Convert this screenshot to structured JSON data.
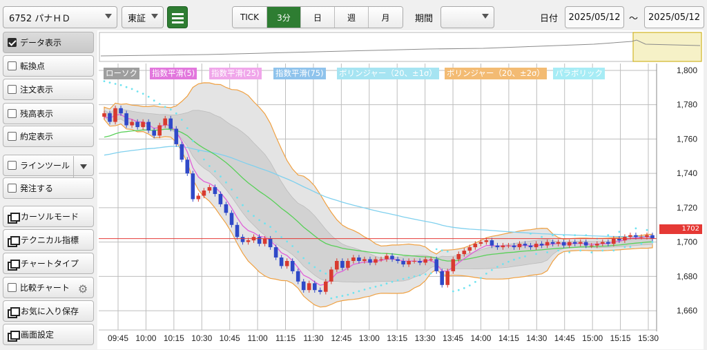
{
  "header": {
    "symbol": "6752 パナＨＤ",
    "market": "東証",
    "periods": [
      "TICK",
      "3分",
      "日",
      "週",
      "月"
    ],
    "active_period": "3分",
    "range_label": "期間",
    "range_value": "",
    "date_label": "日付",
    "date_from": "2025/05/12",
    "date_separator": "〜",
    "date_to": "2025/05/12"
  },
  "sidebar": {
    "data_display": "データ表示",
    "turning_point": "転換点",
    "order_display": "注文表示",
    "balance_display": "残高表示",
    "execution_display": "約定表示",
    "line_tool": "ラインツール",
    "place_order": "発注する",
    "cursor_mode": "カーソルモード",
    "technical": "テクニカル指標",
    "chart_type": "チャートタイプ",
    "compare_chart": "比較チャート",
    "save_favorite": "お気に入り保存",
    "screen_settings": "画面設定"
  },
  "legend": {
    "candle": "ローソク",
    "ema5": "指数平滑(5)",
    "ema25": "指数平滑(25)",
    "ema75": "指数平滑(75)",
    "boll1": "ボリンジャー（20、±1σ）",
    "boll2": "ボリンジャー（20、±2σ）",
    "parabolic": "パラボリック"
  },
  "colors": {
    "up": "#d83a2f",
    "down": "#2f49c8",
    "ema5": "#e060d8",
    "ema25": "#58d058",
    "ema75": "#7fd0ee",
    "band2": "#f0a040",
    "parabolic": "#6fe3f0",
    "price_line": "#e53935",
    "active": "#2e7d32"
  },
  "last_price": "1702",
  "chart_data": {
    "type": "candlestick",
    "x_ticks": [
      "09:45",
      "10:00",
      "10:15",
      "10:30",
      "10:45",
      "11:00",
      "11:15",
      "11:30",
      "12:45",
      "13:00",
      "13:15",
      "13:30",
      "13:45",
      "14:00",
      "14:15",
      "14:30",
      "14:45",
      "15:00",
      "15:15",
      "15:30"
    ],
    "y_ticks": [
      "1,800",
      "1,780",
      "1,760",
      "1,740",
      "1,720",
      "1,700",
      "1,680",
      "1,660"
    ],
    "ylim": [
      1652,
      1804
    ],
    "last_price": 1702,
    "closes": [
      1775,
      1770,
      1778,
      1775,
      1768,
      1770,
      1767,
      1770,
      1765,
      1762,
      1768,
      1772,
      1766,
      1757,
      1748,
      1740,
      1725,
      1727,
      1730,
      1732,
      1728,
      1722,
      1717,
      1710,
      1703,
      1700,
      1701,
      1703,
      1699,
      1702,
      1697,
      1691,
      1686,
      1689,
      1683,
      1677,
      1672,
      1676,
      1672,
      1671,
      1677,
      1684,
      1689,
      1685,
      1689,
      1691,
      1689,
      1690,
      1688,
      1690,
      1690,
      1692,
      1690,
      1689,
      1687,
      1689,
      1689,
      1688,
      1690,
      1690,
      1683,
      1675,
      1683,
      1690,
      1693,
      1695,
      1697,
      1699,
      1700,
      1701,
      1698,
      1697,
      1698,
      1698,
      1697,
      1699,
      1698,
      1697,
      1699,
      1698,
      1700,
      1699,
      1700,
      1698,
      1700,
      1699,
      1700,
      1698,
      1698,
      1699,
      1700,
      1699,
      1702,
      1701,
      1703,
      1704,
      1703,
      1703,
      1704,
      1702
    ]
  }
}
